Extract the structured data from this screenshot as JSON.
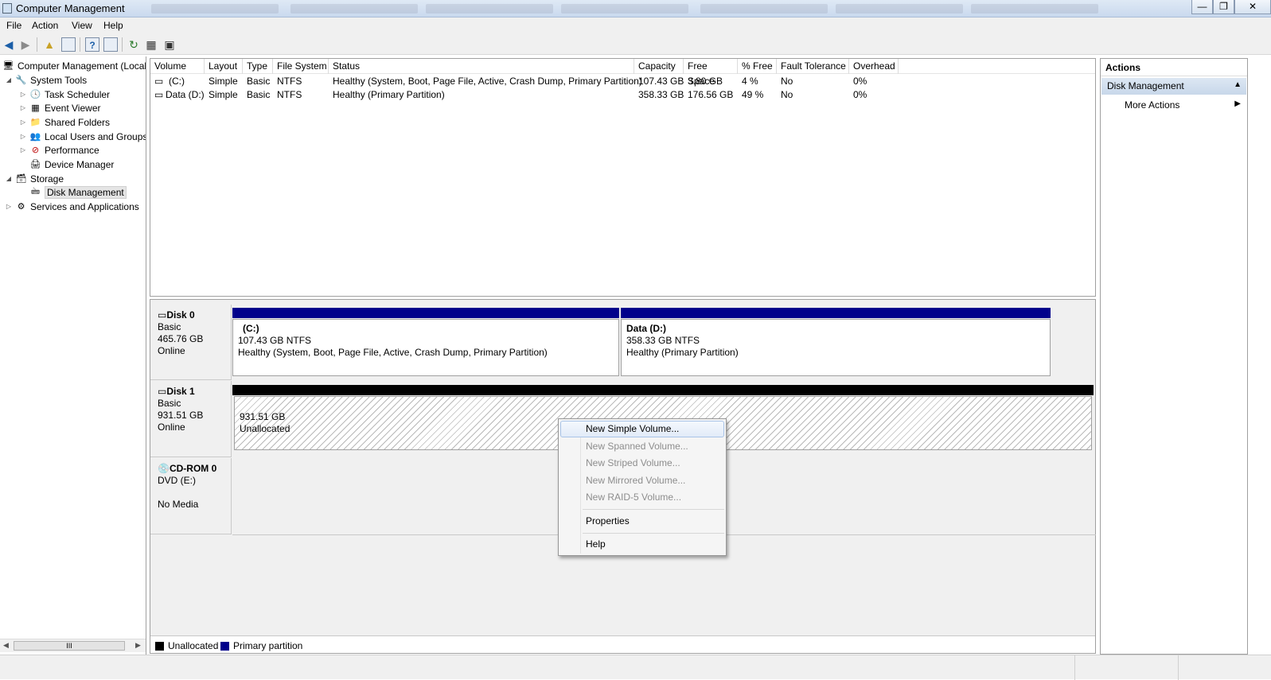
{
  "window": {
    "title": "Computer Management"
  },
  "menu": [
    "File",
    "Action",
    "View",
    "Help"
  ],
  "tree": {
    "root": "Computer Management (Local",
    "system_tools": "System Tools",
    "task_scheduler": "Task Scheduler",
    "event_viewer": "Event Viewer",
    "shared_folders": "Shared Folders",
    "local_users": "Local Users and Groups",
    "performance": "Performance",
    "device_manager": "Device Manager",
    "storage": "Storage",
    "disk_management": "Disk Management",
    "services": "Services and Applications"
  },
  "scrollbar": {
    "grip": "III"
  },
  "volumes": {
    "columns": [
      "Volume",
      "Layout",
      "Type",
      "File System",
      "Status",
      "Capacity",
      "Free Space",
      "% Free",
      "Fault Tolerance",
      "Overhead"
    ],
    "rows": [
      [
        "(C:)",
        "Simple",
        "Basic",
        "NTFS",
        "Healthy (System, Boot, Page File, Active, Crash Dump, Primary Partition)",
        "107.43 GB",
        "3.80 GB",
        "4 %",
        "No",
        "0%"
      ],
      [
        "Data (D:)",
        "Simple",
        "Basic",
        "NTFS",
        "Healthy (Primary Partition)",
        "358.33 GB",
        "176.56 GB",
        "49 %",
        "No",
        "0%"
      ]
    ]
  },
  "disks": [
    {
      "name": "Disk 0",
      "type": "Basic",
      "size": "465.76 GB",
      "state": "Online",
      "partitions": [
        {
          "name": "(C:)",
          "size": "107.43 GB NTFS",
          "status": "Healthy (System, Boot, Page File, Active, Crash Dump, Primary Partition)"
        },
        {
          "name": "Data  (D:)",
          "size": "358.33 GB NTFS",
          "status": "Healthy (Primary Partition)"
        }
      ]
    },
    {
      "name": "Disk 1",
      "type": "Basic",
      "size": "931.51 GB",
      "state": "Online",
      "partitions": [
        {
          "size": "931.51 GB",
          "status": "Unallocated"
        }
      ]
    },
    {
      "name": "CD-ROM 0",
      "type": "DVD (E:)",
      "state": "No Media"
    }
  ],
  "legend": {
    "unallocated": "Unallocated",
    "primary": "Primary partition"
  },
  "actions": {
    "title": "Actions",
    "section": "Disk Management",
    "more": "More Actions"
  },
  "context_menu": {
    "new_simple": "New Simple Volume...",
    "new_spanned": "New Spanned Volume...",
    "new_striped": "New Striped Volume...",
    "new_mirrored": "New Mirrored Volume...",
    "new_raid5": "New RAID-5 Volume...",
    "properties": "Properties",
    "help": "Help"
  },
  "colors": {
    "primary_partition": "#00008b",
    "unallocated": "#000000",
    "selection": "#dde7f3"
  },
  "icons": [
    "back-arrow-icon",
    "forward-arrow-icon",
    "folder-up-icon",
    "console-tree-icon",
    "help-icon",
    "refresh-icon",
    "properties-icon",
    "export-icon",
    "drive-icon",
    "cdrom-icon"
  ]
}
